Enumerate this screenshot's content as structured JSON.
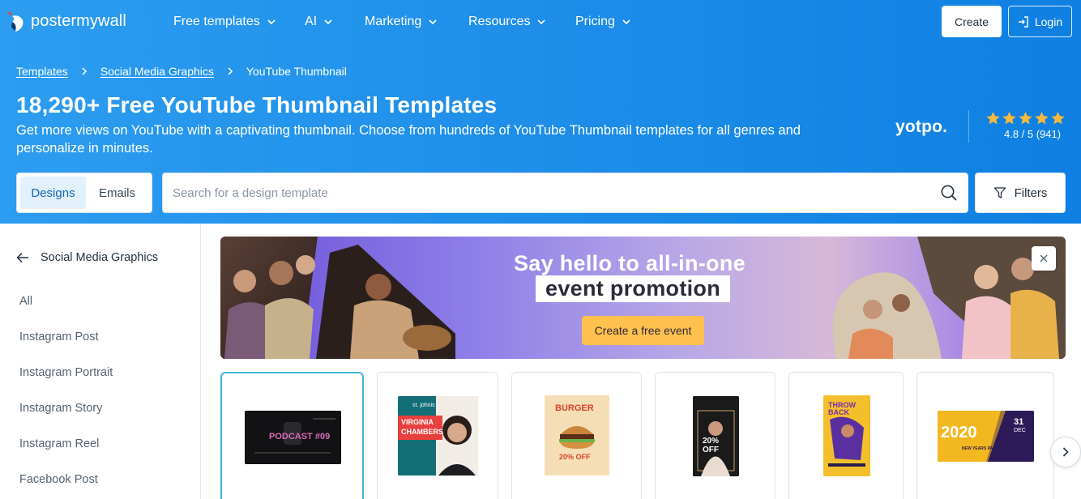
{
  "logo": {
    "text": "postermywall"
  },
  "nav": {
    "items": [
      {
        "label": "Free templates"
      },
      {
        "label": "AI"
      },
      {
        "label": "Marketing"
      },
      {
        "label": "Resources"
      },
      {
        "label": "Pricing"
      }
    ],
    "create_label": "Create",
    "login_label": "Login"
  },
  "breadcrumb": {
    "items": [
      "Templates",
      "Social Media Graphics"
    ],
    "current": "YouTube Thumbnail"
  },
  "hero": {
    "title": "18,290+ Free YouTube Thumbnail Templates",
    "subtitle": "Get more views on YouTube with a captivating thumbnail. Choose from hundreds of YouTube Thumbnail templates for all genres and personalize in minutes."
  },
  "rating": {
    "brand": "yotpo.",
    "stars": 5,
    "text": "4.8 / 5 (941)"
  },
  "tabs": {
    "designs": "Designs",
    "emails": "Emails"
  },
  "search": {
    "placeholder": "Search for a design template"
  },
  "filters_label": "Filters",
  "sidebar": {
    "back_label": "Social Media Graphics",
    "items": [
      "All",
      "Instagram Post",
      "Instagram Portrait",
      "Instagram Story",
      "Instagram Reel",
      "Facebook Post"
    ]
  },
  "banner": {
    "line1": "Say hello to all-in-one",
    "line2": "event promotion",
    "cta": "Create a free event"
  },
  "templates": {
    "t1": {
      "title": "PODCAST #09"
    },
    "t2": {
      "badge": "st. johnis",
      "name": "VIRGINIA CHAMBERS"
    },
    "t3": {
      "title": "BURGER",
      "offer": "20% OFF"
    },
    "t4": {
      "offer": "20% OFF"
    },
    "t5": {
      "title": "THROW BACK"
    },
    "t6": {
      "year": "2020",
      "day": "31",
      "month": "DEC",
      "tag": "NEW YEARS PARTY"
    }
  },
  "colors": {
    "hero_start": "#2c9df0",
    "hero_end": "#0f80e2",
    "accent_cta": "#ffc04d",
    "selected_border": "#3eb5d8"
  }
}
